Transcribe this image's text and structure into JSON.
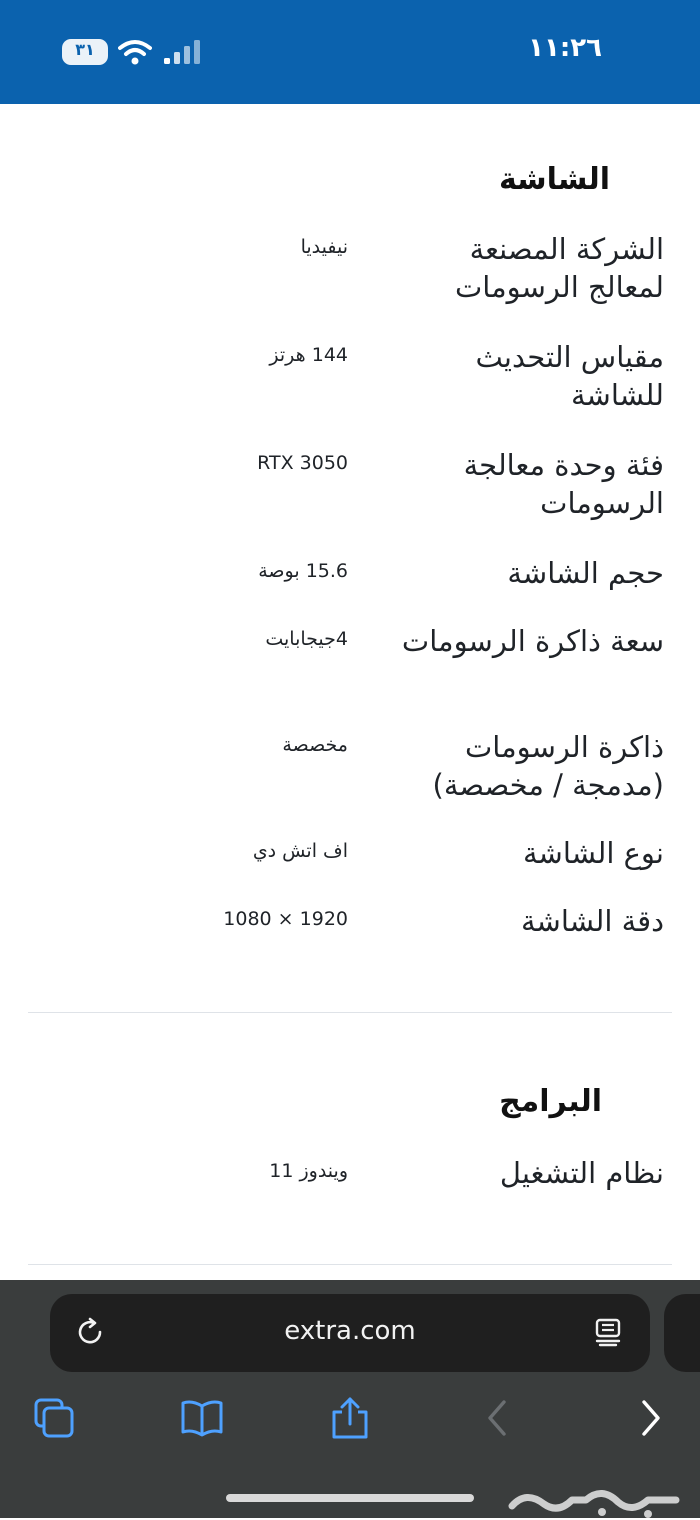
{
  "status_bar": {
    "time": "١١:٢٦",
    "battery": "٣١",
    "background_color": "#0b62ae"
  },
  "sections": {
    "display": {
      "title": "الشاشة",
      "rows": [
        {
          "label": "الشركة المصنعة لمعالج الرسومات",
          "value": "نيفيديا"
        },
        {
          "label": "مقياس التحديث للشاشة",
          "value": "144 هرتز"
        },
        {
          "label": "فئة وحدة معالجة الرسومات",
          "value": "RTX 3050"
        },
        {
          "label": "حجم الشاشة",
          "value": "15.6 بوصة"
        },
        {
          "label": "سعة ذاكرة الرسومات",
          "value": "4جيجابايت"
        },
        {
          "label": "ذاكرة الرسومات (مدمجة / مخصصة)",
          "value": "مخصصة"
        },
        {
          "label": "نوع الشاشة",
          "value": "اف اتش دي"
        },
        {
          "label": "دقة الشاشة",
          "value": "1920 × 1080"
        }
      ]
    },
    "software": {
      "title": "البرامج",
      "rows": [
        {
          "label": "نظام التشغيل",
          "value": "ويندوز 11"
        }
      ]
    }
  },
  "browser": {
    "url": "extra.com",
    "icons": [
      "reload-icon",
      "reader-mode-icon",
      "tabs-icon",
      "bookmarks-icon",
      "share-icon",
      "back-icon",
      "forward-icon"
    ]
  },
  "watermark": {
    "text": "حراج"
  }
}
